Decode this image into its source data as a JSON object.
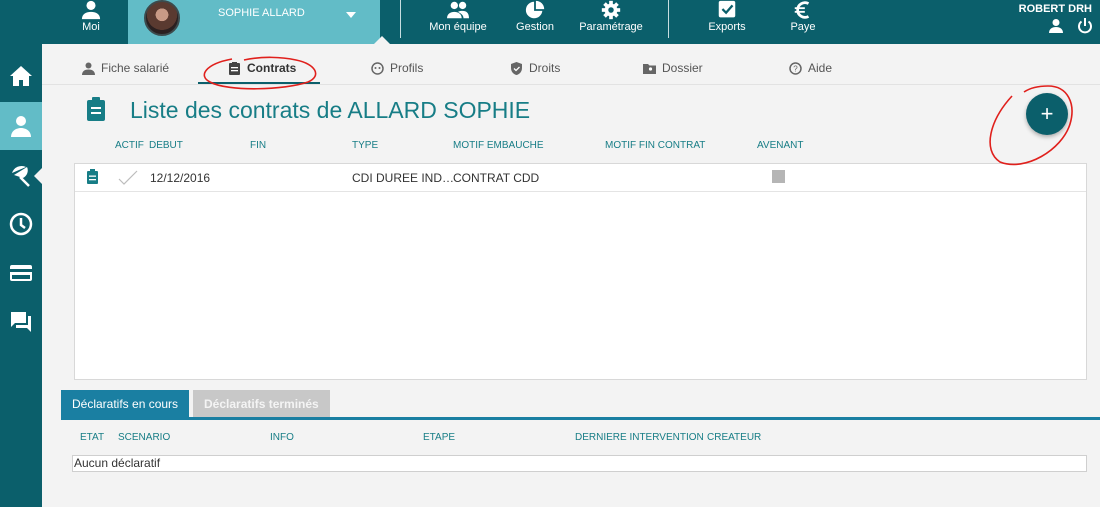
{
  "topbar": {
    "moi": "Moi",
    "user_name": "SOPHIE ALLARD",
    "nav": [
      {
        "label": "Mon équipe"
      },
      {
        "label": "Gestion"
      },
      {
        "label": "Paramétrage"
      },
      {
        "label": "Exports"
      },
      {
        "label": "Paye"
      }
    ],
    "current_user": "ROBERT DRH"
  },
  "tabs": [
    {
      "label": "Fiche salarié"
    },
    {
      "label": "Contrats"
    },
    {
      "label": "Profils"
    },
    {
      "label": "Droits"
    },
    {
      "label": "Dossier"
    },
    {
      "label": "Aide"
    }
  ],
  "page_title": "Liste des contrats de ALLARD SOPHIE",
  "add_button": "+",
  "contracts": {
    "columns": [
      "ACTIF",
      "DEBUT",
      "FIN",
      "TYPE",
      "MOTIF EMBAUCHE",
      "MOTIF FIN CONTRAT",
      "AVENANT"
    ],
    "rows": [
      {
        "debut": "12/12/2016",
        "fin": "",
        "type": "CDI DUREE IND…",
        "motif_embauche": "CONTRAT CDD",
        "motif_fin": ""
      }
    ]
  },
  "declaratifs": {
    "tabs": [
      "Déclaratifs en cours",
      "Déclaratifs terminés"
    ],
    "columns": [
      "ETAT",
      "SCENARIO",
      "INFO",
      "ETAPE",
      "DERNIERE INTERVENTION",
      "CREATEUR"
    ],
    "empty_text": "Aucun déclaratif"
  },
  "colors": {
    "primary": "#0b5f6b",
    "accent": "#62bcc7",
    "title": "#177d86",
    "tab_blue": "#1a7fa2",
    "annotation": "#e0201c"
  }
}
